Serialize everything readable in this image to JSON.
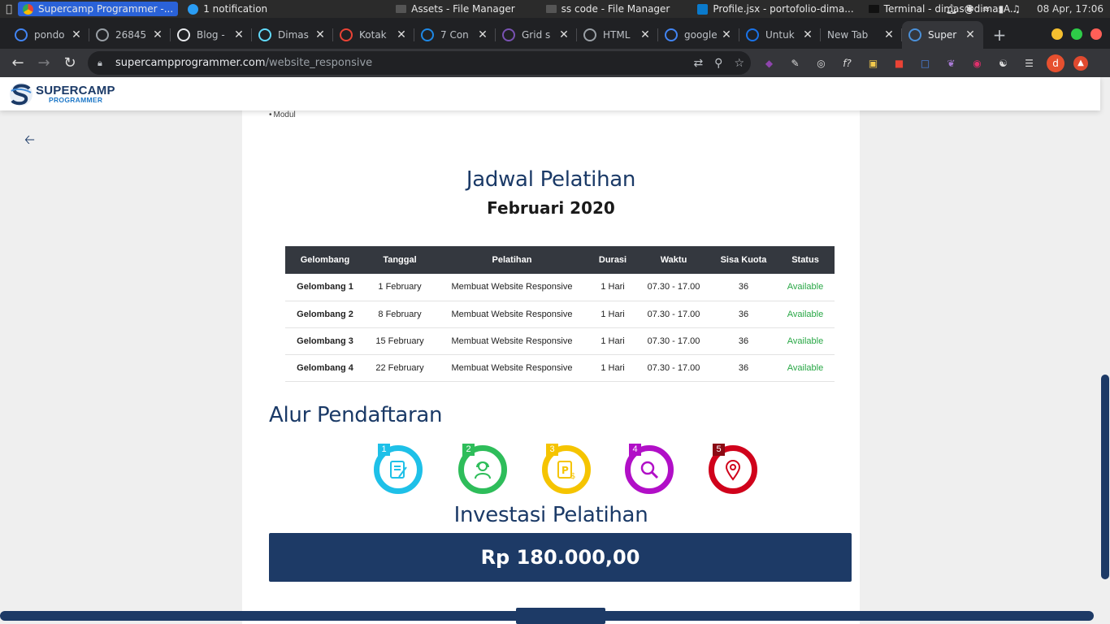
{
  "os": {
    "apps": [
      {
        "label": "Supercamp Programmer -...",
        "active": true
      },
      {
        "label": "1 notification",
        "active": false
      },
      {
        "label": "Assets - File Manager",
        "active": false
      },
      {
        "label": "ss code - File Manager",
        "active": false
      },
      {
        "label": "Profile.jsx - portofolio-dima...",
        "active": false
      },
      {
        "label": "Terminal - dimas@dimasA...",
        "active": false
      }
    ],
    "clock": "08 Apr, 17:06"
  },
  "tabs": [
    {
      "title": "pondo",
      "icon": "google-icon",
      "color": "#4285f4"
    },
    {
      "title": "26845",
      "icon": "globe-icon",
      "color": "#9aa0a6"
    },
    {
      "title": "Blog -",
      "icon": "r-logo-icon",
      "color": "#e8eaed"
    },
    {
      "title": "Dimas",
      "icon": "react-icon",
      "color": "#61dafb"
    },
    {
      "title": "Kotak",
      "icon": "gmail-icon",
      "color": "#ea4335"
    },
    {
      "title": "7 Con",
      "icon": "swirl-icon",
      "color": "#1e88e5"
    },
    {
      "title": "Grid s",
      "icon": "bootstrap-icon",
      "color": "#7952b3"
    },
    {
      "title": "HTML",
      "icon": "globe-icon",
      "color": "#9aa0a6"
    },
    {
      "title": "google",
      "icon": "google-icon",
      "color": "#4285f4"
    },
    {
      "title": "Untuk",
      "icon": "blue-swirl-icon",
      "color": "#1a73e8"
    },
    {
      "title": "New Tab",
      "icon": "",
      "color": ""
    },
    {
      "title": "Super",
      "icon": "supercamp-icon",
      "color": "#4a90d9",
      "active": true
    }
  ],
  "address": {
    "host": "supercampprogrammer.com",
    "path": "/website_responsive"
  },
  "profile_initial": "d",
  "site": {
    "logo_top": "SUPERCAMP",
    "logo_bottom": "PROGRAMMER",
    "modul_label": "Modul"
  },
  "schedule": {
    "title": "Jadwal Pelatihan",
    "subtitle": "Februari 2020",
    "headers": [
      "Gelombang",
      "Tanggal",
      "Pelatihan",
      "Durasi",
      "Waktu",
      "Sisa Kuota",
      "Status"
    ],
    "rows": [
      [
        "Gelombang 1",
        "1 February",
        "Membuat Website Responsive",
        "1 Hari",
        "07.30 - 17.00",
        "36",
        "Available"
      ],
      [
        "Gelombang 2",
        "8 February",
        "Membuat Website Responsive",
        "1 Hari",
        "07.30 - 17.00",
        "36",
        "Available"
      ],
      [
        "Gelombang 3",
        "15 February",
        "Membuat Website Responsive",
        "1 Hari",
        "07.30 - 17.00",
        "36",
        "Available"
      ],
      [
        "Gelombang 4",
        "22 February",
        "Membuat Website Responsive",
        "1 Hari",
        "07.30 - 17.00",
        "36",
        "Available"
      ]
    ]
  },
  "alur": {
    "title": "Alur Pendaftaran",
    "steps": [
      {
        "num": "1",
        "color": "#1ec0e8",
        "icon": "form-icon"
      },
      {
        "num": "2",
        "color": "#2ebd5a",
        "icon": "support-agent-icon"
      },
      {
        "num": "3",
        "color": "#f5c400",
        "icon": "payment-icon"
      },
      {
        "num": "4",
        "color": "#b10fc7",
        "icon": "search-icon"
      },
      {
        "num": "5",
        "color": "#d0021b",
        "icon": "location-pin-icon"
      }
    ]
  },
  "investasi": {
    "title": "Investasi Pelatihan",
    "price": "Rp 180.000,00"
  },
  "colors": {
    "brand_navy": "#1d3a66",
    "available": "#28a745",
    "table_header": "#34383f"
  }
}
